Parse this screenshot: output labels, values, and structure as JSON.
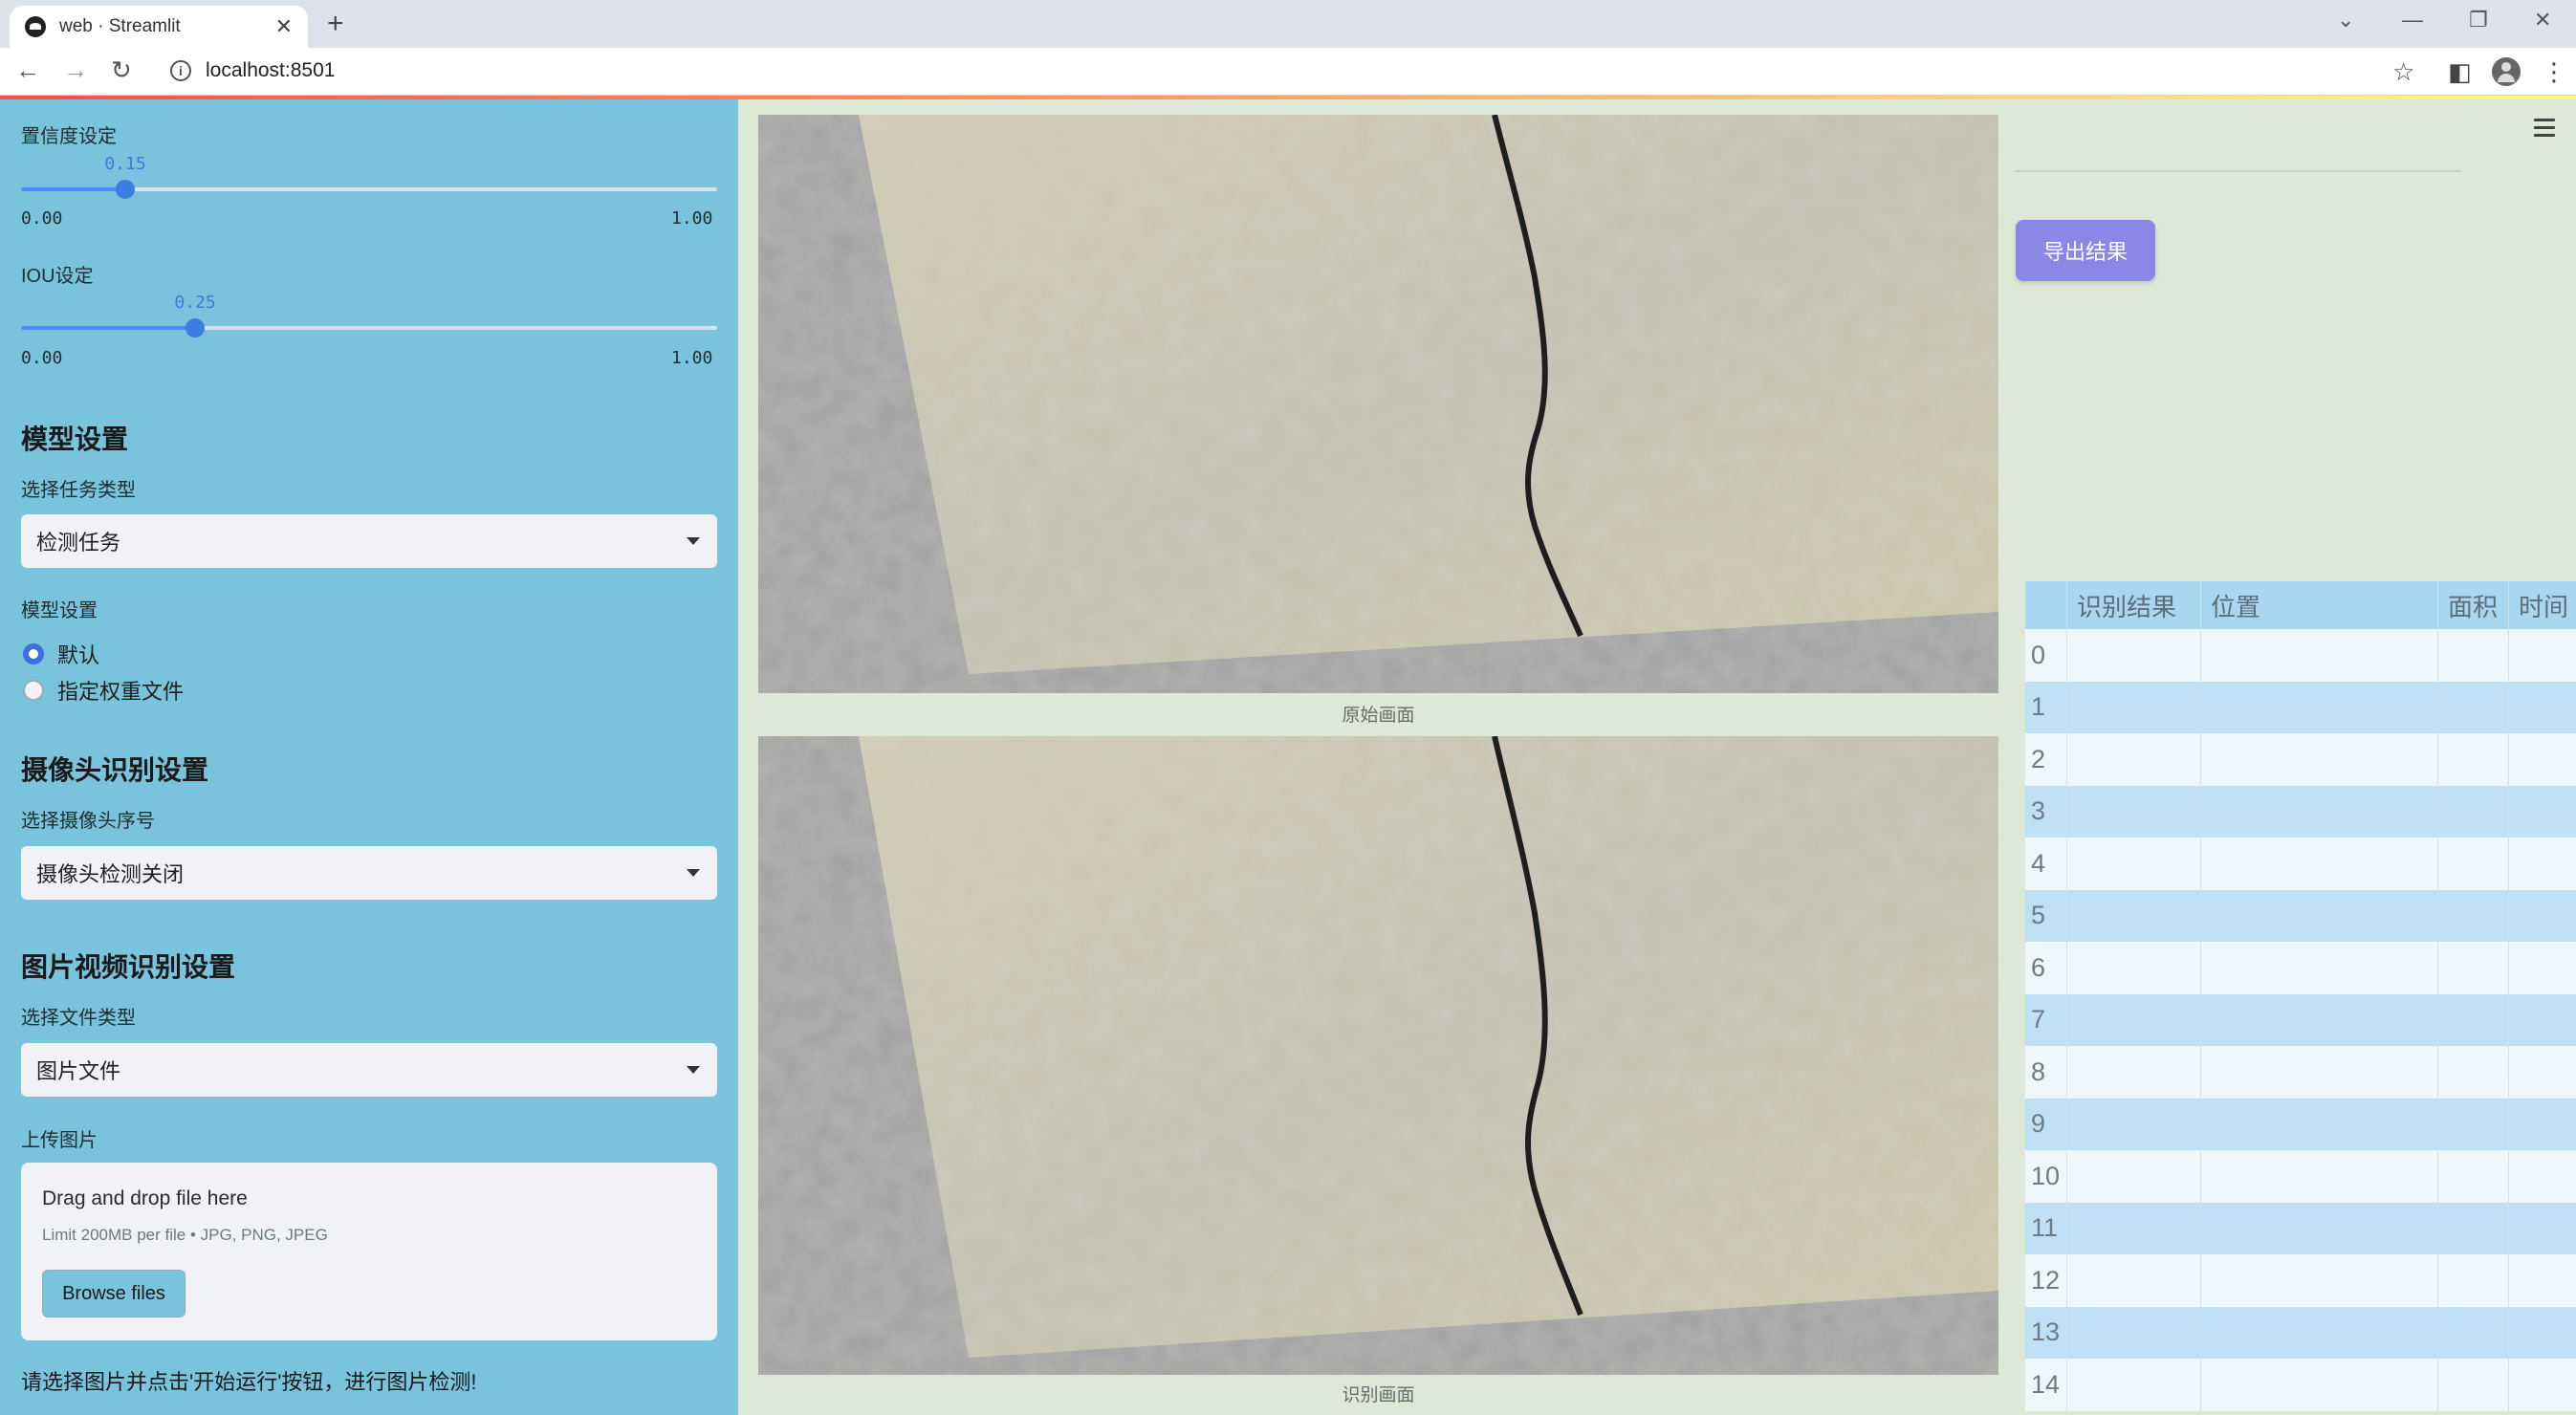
{
  "browser": {
    "tab_title": "web · Streamlit",
    "url": "localhost:8501"
  },
  "sidebar": {
    "confidence": {
      "label": "置信度设定",
      "value": "0.15",
      "min": "0.00",
      "max": "1.00",
      "fraction": 0.15
    },
    "iou": {
      "label": "IOU设定",
      "value": "0.25",
      "min": "0.00",
      "max": "1.00",
      "fraction": 0.25
    },
    "model_heading": "模型设置",
    "task_label": "选择任务类型",
    "task_value": "检测任务",
    "model_label": "模型设置",
    "model_options": [
      {
        "label": "默认",
        "checked": true
      },
      {
        "label": "指定权重文件",
        "checked": false
      }
    ],
    "camera_heading": "摄像头识别设置",
    "camera_label": "选择摄像头序号",
    "camera_value": "摄像头检测关闭",
    "media_heading": "图片视频识别设置",
    "file_type_label": "选择文件类型",
    "file_type_value": "图片文件",
    "upload_label": "上传图片",
    "upload": {
      "title": "Drag and drop file here",
      "limit": "Limit 200MB per file • JPG, PNG, JPEG",
      "button": "Browse files"
    },
    "hint": "请选择图片并点击'开始运行'按钮，进行图片检测!"
  },
  "main": {
    "original_caption": "原始画面",
    "result_caption": "识别画面"
  },
  "right": {
    "export_button": "导出结果",
    "table": {
      "headers": [
        "",
        "识别结果",
        "位置",
        "面积",
        "时间"
      ],
      "row_indices": [
        "0",
        "1",
        "2",
        "3",
        "4",
        "5",
        "6",
        "7",
        "8",
        "9",
        "10",
        "11",
        "12",
        "13",
        "14"
      ]
    }
  },
  "colors": {
    "sidebar_bg": "#79c3dc",
    "main_bg": "#dee8d6",
    "accent": "#3b7de0",
    "export_btn": "#8a88e6"
  }
}
